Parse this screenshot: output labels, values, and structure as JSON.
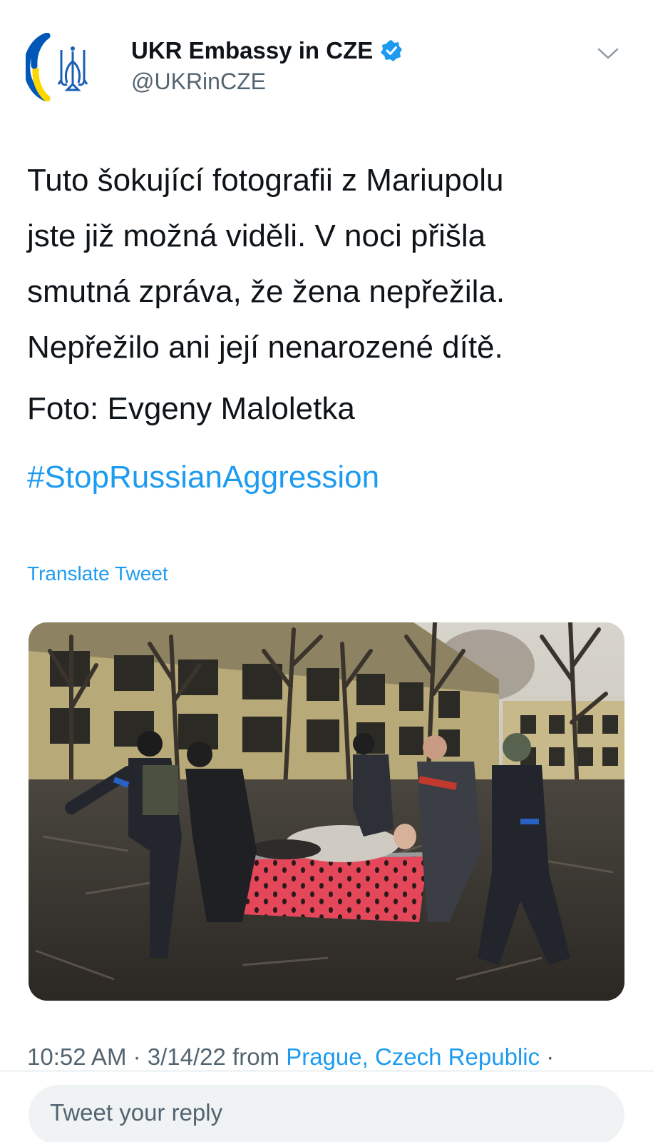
{
  "author": {
    "name": "UKR Embassy in CZE",
    "handle": "@UKRinCZE",
    "verified": true
  },
  "icons": {
    "avatar": "ukraine-trident-icon",
    "verified": "verified-badge-icon",
    "menu": "chevron-down-icon"
  },
  "tweet": {
    "lines": [
      "Tuto šokující fotografii z Mariupolu",
      "jste již možná viděli. V noci přišla",
      "smutná zpráva, že žena nepřežila.",
      "Nepřežilo ani její nenarozené dítě."
    ],
    "credit": "Foto: Evgeny Maloletka",
    "hashtag": "#StopRussianAggression",
    "translate_label": "Translate Tweet"
  },
  "meta": {
    "time": "10:52 AM",
    "sep1": " · ",
    "date": "3/14/22",
    "from_label": " from ",
    "location": "Prague, Czech Republic",
    "sep2": " ·"
  },
  "reply": {
    "placeholder": "Tweet your reply"
  },
  "colors": {
    "link": "#1d9bf0",
    "secondary_text": "#536471",
    "avatar_blue": "#0057b8",
    "avatar_yellow": "#ffd700"
  }
}
